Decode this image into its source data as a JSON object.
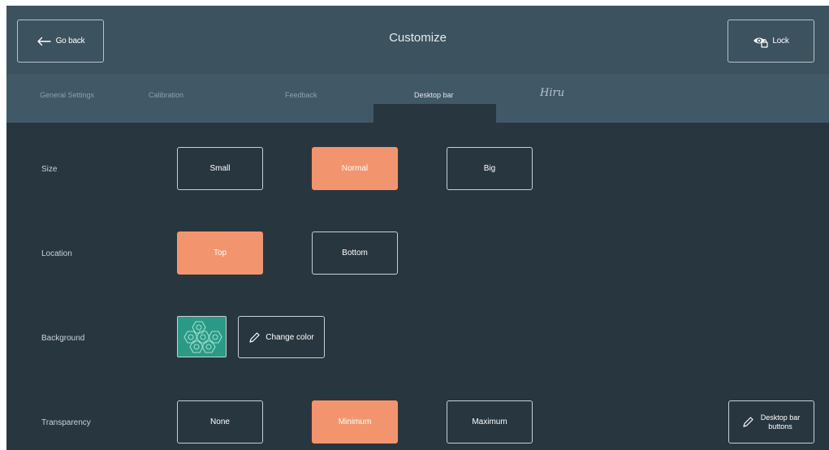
{
  "header": {
    "title": "Customize",
    "back_label": "Go back",
    "lock_label": "Lock"
  },
  "tabs": [
    {
      "label": "General Settings"
    },
    {
      "label": "Calibration"
    },
    {
      "label": "Feedback"
    },
    {
      "label": "Desktop bar",
      "active": true
    },
    {
      "label": "Hiru"
    }
  ],
  "settings": {
    "size": {
      "label": "Size",
      "options": [
        "Small",
        "Normal",
        "Big"
      ],
      "selected": "Normal"
    },
    "location": {
      "label": "Location",
      "options": [
        "Top",
        "Bottom"
      ],
      "selected": "Top"
    },
    "background": {
      "label": "Background",
      "change_color_label": "Change color",
      "swatch_color": "#2a9a86"
    },
    "transparency": {
      "label": "Transparency",
      "options": [
        "None",
        "Minimum",
        "Maximum"
      ],
      "selected": "Minimum"
    }
  },
  "desktop_bar_buttons_label": "Desktop bar buttons",
  "colors": {
    "header_bg": "#3d525f",
    "tabs_bg": "#415866",
    "content_bg": "#283640",
    "accent": "#f2956e"
  },
  "icons": {
    "back": "arrow-left-icon",
    "lock": "eye-lock-icon",
    "edit": "pencil-icon"
  }
}
